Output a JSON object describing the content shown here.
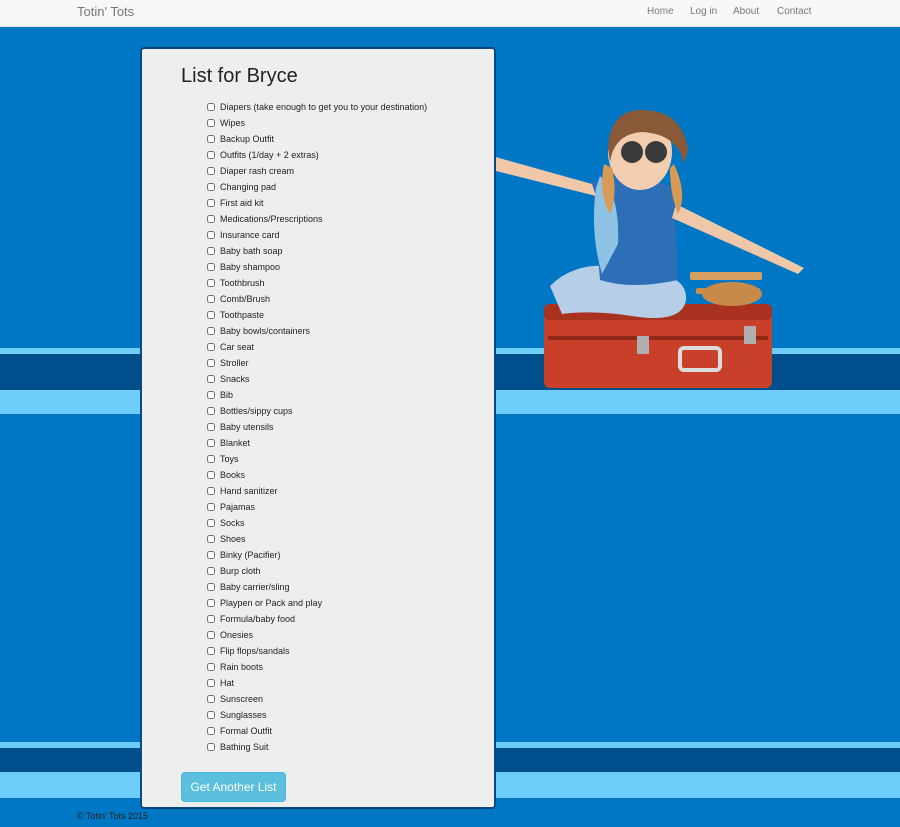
{
  "nav": {
    "brand": "Totin' Tots",
    "links": [
      "Home",
      "Log in",
      "About",
      "Contact"
    ]
  },
  "list": {
    "title": "List for Bryce",
    "items": [
      "Diapers (take enough to get you to your destination)",
      "Wipes",
      "Backup Outfit",
      "Outfits (1/day + 2 extras)",
      "Diaper rash cream",
      "Changing pad",
      "First aid kit",
      "Medications/Prescriptions",
      "Insurance card",
      "Baby bath soap",
      "Baby shampoo",
      "Toothbrush",
      "Comb/Brush",
      "Toothpaste",
      "Baby bowls/containers",
      "Car seat",
      "Stroller",
      "Snacks",
      "Bib",
      "Bottles/sippy cups",
      "Baby utensils",
      "Blanket",
      "Toys",
      "Books",
      "Hand sanitizer",
      "Pajamas",
      "Socks",
      "Shoes",
      "Binky (Pacifier)",
      "Burp cloth",
      "Baby carrier/sling",
      "Playpen or Pack and play",
      "Formula/baby food",
      "Onesies",
      "Flip flops/sandals",
      "Rain boots",
      "Hat",
      "Sunscreen",
      "Sunglasses",
      "Formal Outfit",
      "Bathing Suit"
    ],
    "button": "Get Another List"
  },
  "footer": "© Totin' Tots 2015",
  "colors": {
    "background": "#0077c4",
    "stripe_light": "#6ccdfa",
    "stripe_dark": "#004e8c",
    "button": "#5bc0de",
    "panel": "#eeeeee"
  }
}
